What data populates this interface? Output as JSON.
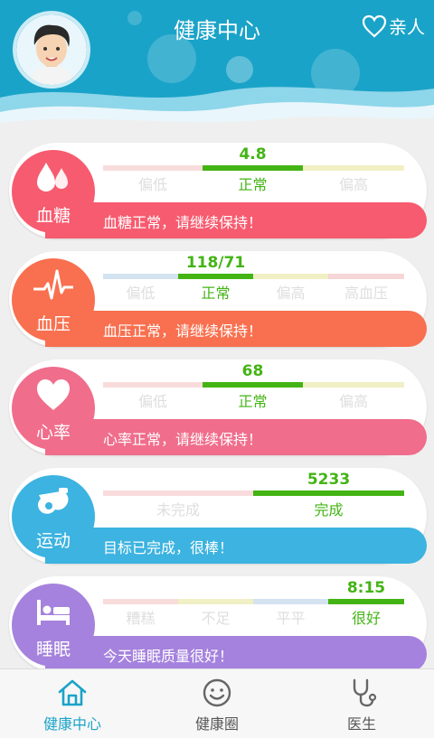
{
  "header": {
    "title": "健康中心",
    "family_label": "亲人"
  },
  "cards": {
    "sugar": {
      "label": "血糖",
      "value": "4.8",
      "segments": [
        "偏低",
        "正常",
        "偏高"
      ],
      "message": "血糖正常，请继续保持！",
      "color": "#f75b6f"
    },
    "pressure": {
      "label": "血压",
      "value": "118/71",
      "segments": [
        "偏低",
        "正常",
        "偏高",
        "高血压"
      ],
      "message": "血压正常，请继续保持！",
      "color": "#f8704f"
    },
    "heart": {
      "label": "心率",
      "value": "68",
      "segments": [
        "偏低",
        "正常",
        "偏高"
      ],
      "message": "心率正常，请继续保持！",
      "color": "#f06d8b"
    },
    "sport": {
      "label": "运动",
      "value": "5233",
      "segments": [
        "未完成",
        "完成"
      ],
      "message": "目标已完成，很棒！",
      "color": "#3cb3e0"
    },
    "sleep": {
      "label": "睡眠",
      "value": "8:15",
      "segments": [
        "糟糕",
        "不足",
        "平平",
        "很好"
      ],
      "message": "今天睡眠质量很好！",
      "color": "#a582dd"
    }
  },
  "tabs": [
    {
      "label": "健康中心",
      "icon": "home-icon"
    },
    {
      "label": "健康圈",
      "icon": "smile-icon"
    },
    {
      "label": "医生",
      "icon": "stethoscope-icon"
    }
  ],
  "colors": {
    "header": "#1aa3c8",
    "active": "#43b414",
    "inactive_label": "#dedede"
  }
}
